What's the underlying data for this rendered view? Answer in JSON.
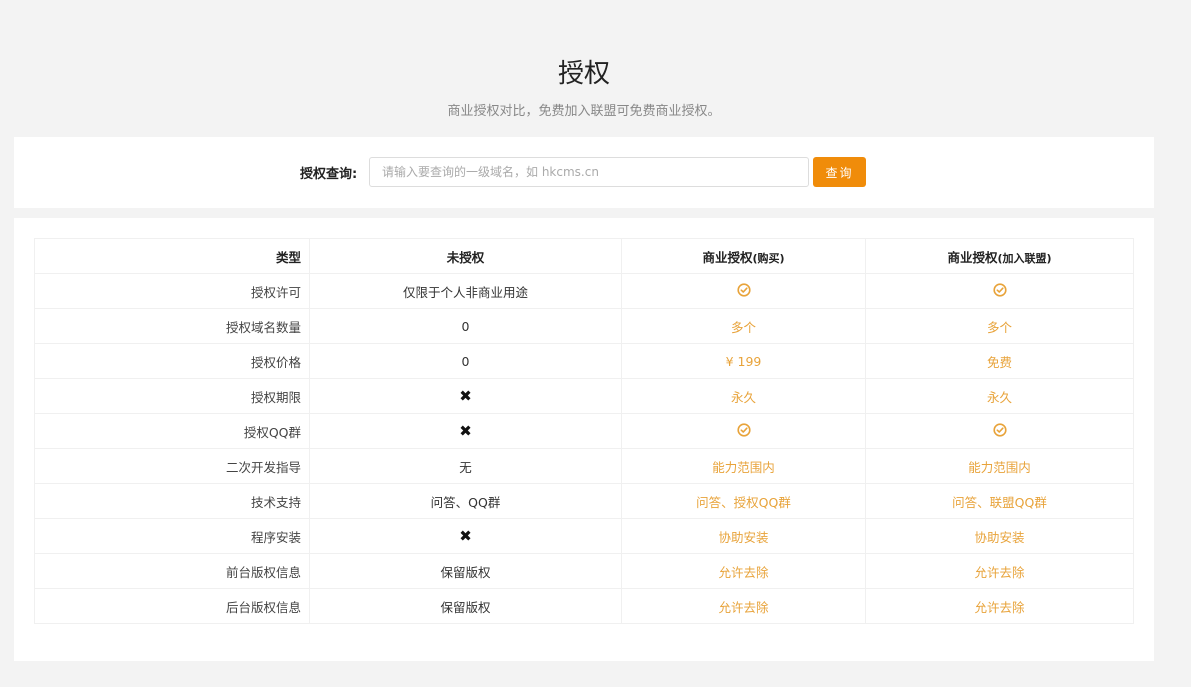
{
  "header": {
    "title": "授权",
    "subtitle": "商业授权对比，免费加入联盟可免费商业授权。"
  },
  "query": {
    "label": "授权查询:",
    "placeholder": "请输入要查询的一级域名，如 hkcms.cn",
    "value": "",
    "button_label": "查询"
  },
  "colors": {
    "accent": "#f08c0a",
    "highlight_text": "#e8a33a"
  },
  "table": {
    "headers": {
      "type": "类型",
      "free": "未授权",
      "buy": "商业授权",
      "buy_suffix": "(购买)",
      "join": "商业授权",
      "join_suffix": "(加入联盟)"
    },
    "rows": [
      {
        "type": "授权许可",
        "free": "仅限于个人非商业用途",
        "buy": "check-icon",
        "join": "check-icon"
      },
      {
        "type": "授权域名数量",
        "free": "0",
        "buy": "多个",
        "join": "多个"
      },
      {
        "type": "授权价格",
        "free": "0",
        "buy": "¥ 199",
        "join": "免费"
      },
      {
        "type": "授权期限",
        "free": "cross-icon",
        "buy": "永久",
        "join": "永久"
      },
      {
        "type": "授权QQ群",
        "free": "cross-icon",
        "buy": "check-icon",
        "join": "check-icon"
      },
      {
        "type": "二次开发指导",
        "free": "无",
        "buy": "能力范围内",
        "join": "能力范围内"
      },
      {
        "type": "技术支持",
        "free": "问答、QQ群",
        "buy": "问答、授权QQ群",
        "join": "问答、联盟QQ群"
      },
      {
        "type": "程序安装",
        "free": "cross-icon",
        "buy": "协助安装",
        "join": "协助安装"
      },
      {
        "type": "前台版权信息",
        "free": "保留版权",
        "buy": "允许去除",
        "join": "允许去除"
      },
      {
        "type": "后台版权信息",
        "free": "保留版权",
        "buy": "允许去除",
        "join": "允许去除"
      }
    ]
  }
}
